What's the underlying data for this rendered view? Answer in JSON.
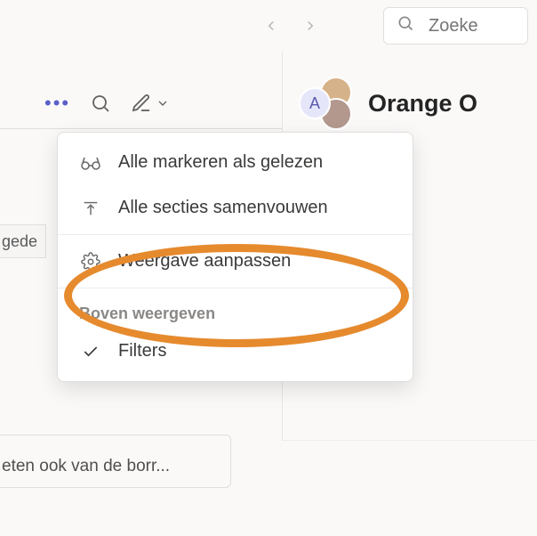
{
  "topbar": {
    "search_placeholder": "Zoeke"
  },
  "left": {
    "truncated_tag": "gede",
    "bottom_row": "eten ook van de borr..."
  },
  "right": {
    "avatar_letter": "A",
    "title": "Orange O"
  },
  "menu": {
    "mark_all_read": "Alle markeren als gelezen",
    "collapse_all": "Alle secties samenvouwen",
    "customize_view": "Weergave aanpassen",
    "section_label": "Boven weergeven",
    "filters": "Filters"
  }
}
